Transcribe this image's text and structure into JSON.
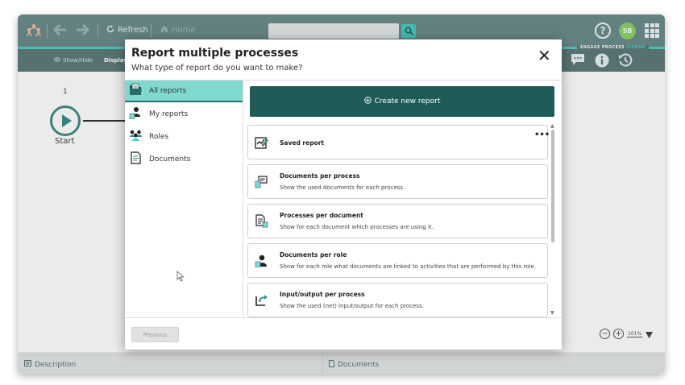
{
  "toolbar": {
    "refresh_label": "Refresh",
    "home_label": "Home",
    "avatar_initials": "SB",
    "help_glyph": "?"
  },
  "subbar": {
    "show_hide_label": "Show/Hide",
    "display_label": "Display",
    "app_title_main": "ENGAGE PROCESS",
    "app_title_accent": "VIEWER"
  },
  "canvas": {
    "step_number": "1",
    "start_label": "Start",
    "zoom_level": "101%"
  },
  "bottom": {
    "description_label": "Description",
    "documents_label": "Documents"
  },
  "dialog": {
    "title": "Report multiple processes",
    "subtitle": "What type of report do you want to make?",
    "close_glyph": "✕",
    "left_menu": [
      {
        "label": "All reports",
        "icon": "folder-report-icon",
        "active": true
      },
      {
        "label": "My reports",
        "icon": "person-document-icon",
        "active": false
      },
      {
        "label": "Roles",
        "icon": "roles-group-icon",
        "active": false
      },
      {
        "label": "Documents",
        "icon": "document-icon",
        "active": false
      }
    ],
    "create_button": "Create new report",
    "reports": [
      {
        "title": "Saved report",
        "description": "",
        "icon": "saved-report-icon",
        "has_menu": true
      },
      {
        "title": "Documents per process",
        "description": "Show the used documents for each process.",
        "icon": "documents-per-process-icon"
      },
      {
        "title": "Processes per document",
        "description": "Show for each document which processes are using it.",
        "icon": "processes-per-document-icon"
      },
      {
        "title": "Documents per role",
        "description": "Show for each role what documents are linked to activities that are performed by this role.",
        "icon": "documents-per-role-icon"
      },
      {
        "title": "Input/output per process",
        "description": "Show the used (net) input/output for each process.",
        "icon": "input-output-icon"
      }
    ],
    "card_menu_glyph": "•••",
    "previous_button": "Previous"
  },
  "colors": {
    "topbar": "#6d8d8d",
    "accent": "#4fcfc4",
    "primary_dark": "#1f5b57",
    "active_tab": "#7fd9cf",
    "avatar": "#8fcf6a"
  }
}
